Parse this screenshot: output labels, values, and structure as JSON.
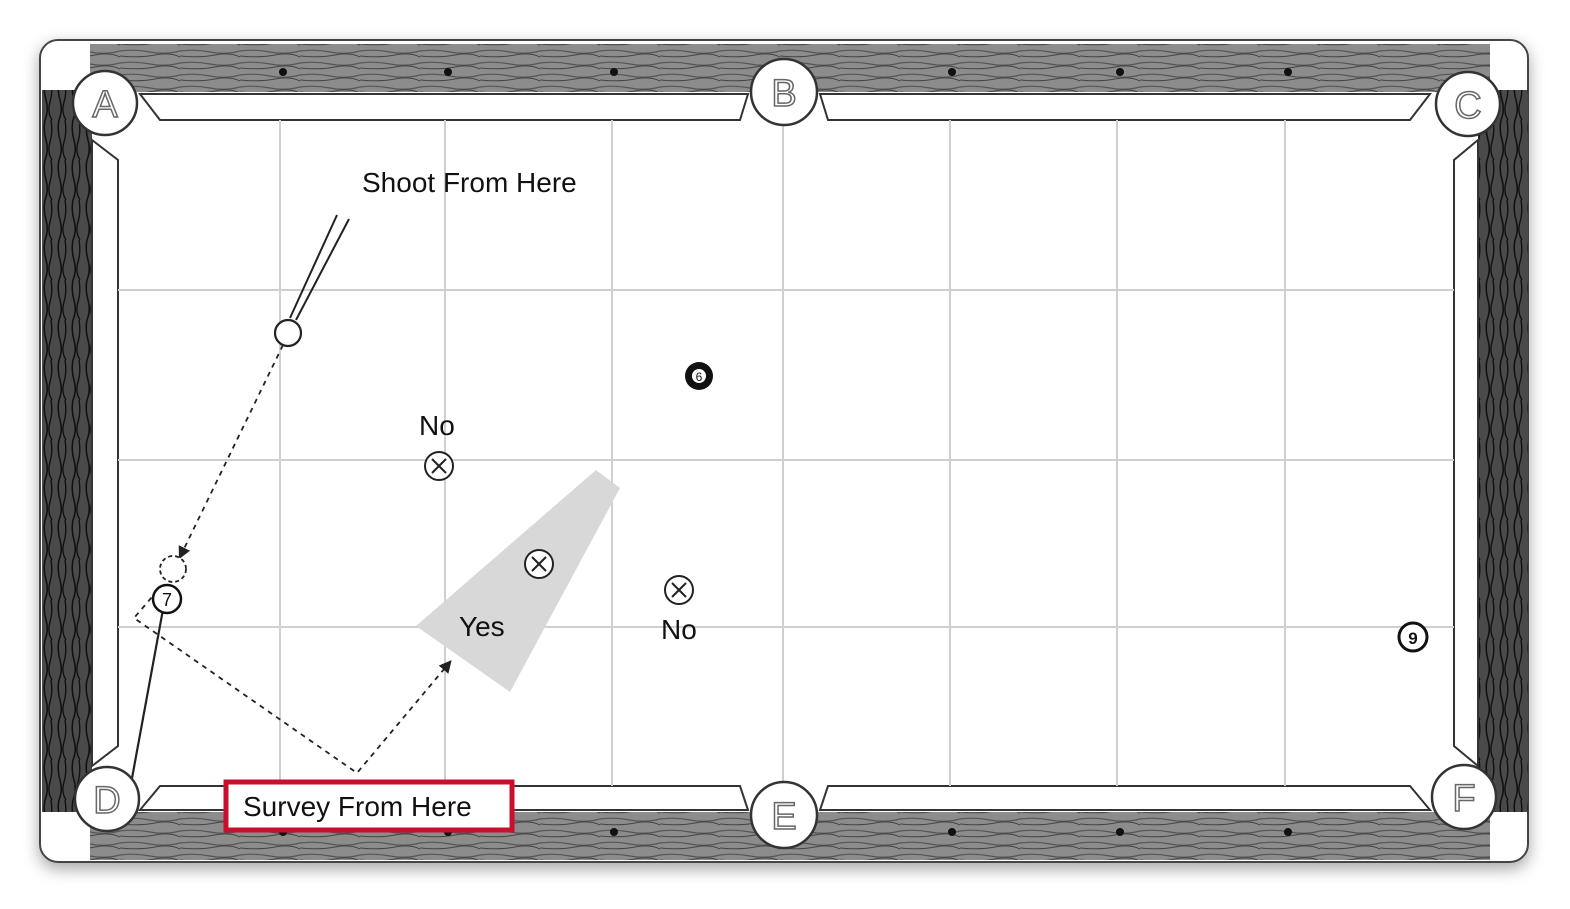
{
  "labels": {
    "shoot": "Shoot From Here",
    "survey": "Survey From Here",
    "yes": "Yes",
    "no_upper": "No",
    "no_lower": "No"
  },
  "pockets": [
    "A",
    "B",
    "C",
    "D",
    "E",
    "F"
  ],
  "balls": {
    "six": "6",
    "seven": "7",
    "nine": "9"
  },
  "colors": {
    "rail_dark": "#3a3a3a",
    "rail_wood": "#9a9a9a",
    "grid": "#cfcfcf",
    "highlight_box": "#c8102e",
    "yes_zone": "#d8d8d8"
  },
  "icons": {
    "target_marker": "circled-x-icon",
    "cue_stick": "cue-stick-icon",
    "ghost_ball": "dashed-circle-icon"
  }
}
